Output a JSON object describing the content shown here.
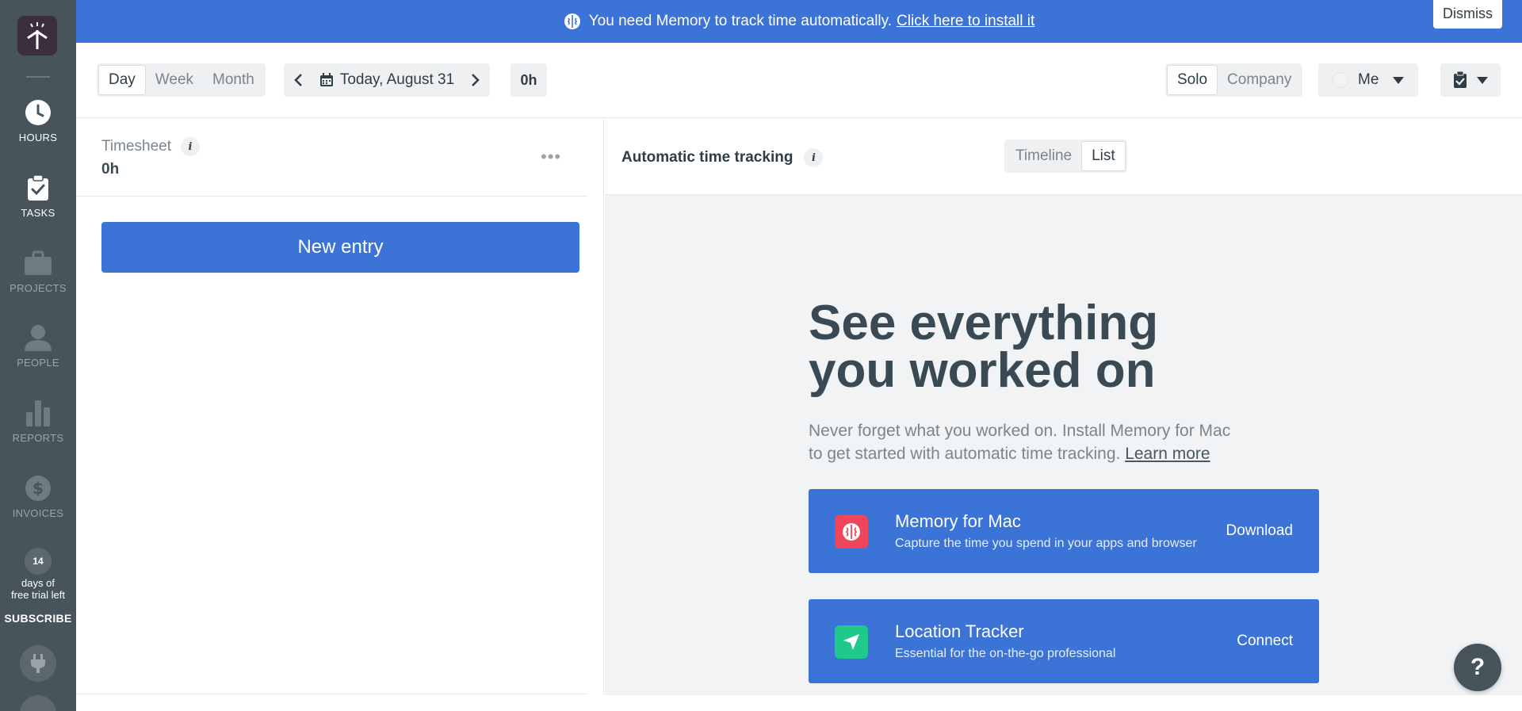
{
  "banner": {
    "message": "You need Memory to track time automatically.",
    "link": "Click here to install it",
    "dismiss": "Dismiss"
  },
  "sidebar": {
    "items": [
      {
        "label": "HOURS",
        "icon": "clock-icon",
        "active": true
      },
      {
        "label": "TASKS",
        "icon": "task-check-icon",
        "active": true
      },
      {
        "label": "PROJECTS",
        "icon": "briefcase-icon",
        "active": false
      },
      {
        "label": "PEOPLE",
        "icon": "person-icon",
        "active": false
      },
      {
        "label": "REPORTS",
        "icon": "bar-chart-icon",
        "active": false
      },
      {
        "label": "INVOICES",
        "icon": "dollar-icon",
        "active": false
      }
    ],
    "trial_days": "14",
    "trial_line1": "days of",
    "trial_line2": "free trial left",
    "subscribe": "SUBSCRIBE"
  },
  "toolbar": {
    "range_options": [
      "Day",
      "Week",
      "Month"
    ],
    "range_selected": "Day",
    "date_label": "Today, August 31",
    "total": "0h",
    "scope_options": [
      "Solo",
      "Company"
    ],
    "scope_selected": "Solo",
    "user_label": "Me"
  },
  "timesheet": {
    "title": "Timesheet",
    "total": "0h",
    "new_entry": "New entry"
  },
  "tracking": {
    "title": "Automatic time tracking",
    "view_options": [
      "Timeline",
      "List"
    ],
    "view_selected": "List",
    "hero_line1": "See everything",
    "hero_line2": "you worked on",
    "sub_line1": "Never forget what you worked on. Install Memory for Mac",
    "sub_line2": "to get started with automatic time tracking.",
    "learn_more": "Learn more",
    "cards": [
      {
        "title": "Memory for Mac",
        "subtitle": "Capture the time you spend in your apps and browser",
        "action": "Download",
        "icon": "brain-icon",
        "color": "#f0465c"
      },
      {
        "title": "Location Tracker",
        "subtitle": "Essential for the on-the-go professional",
        "action": "Connect",
        "icon": "location-arrow-icon",
        "color": "#1fc98b"
      }
    ]
  },
  "info_glyph": "i",
  "more_glyph": "•••",
  "help_glyph": "?",
  "colors": {
    "primary": "#3b73d6",
    "sidebar": "#47545c",
    "memory_red": "#f0465c",
    "location_green": "#1fc98b"
  }
}
